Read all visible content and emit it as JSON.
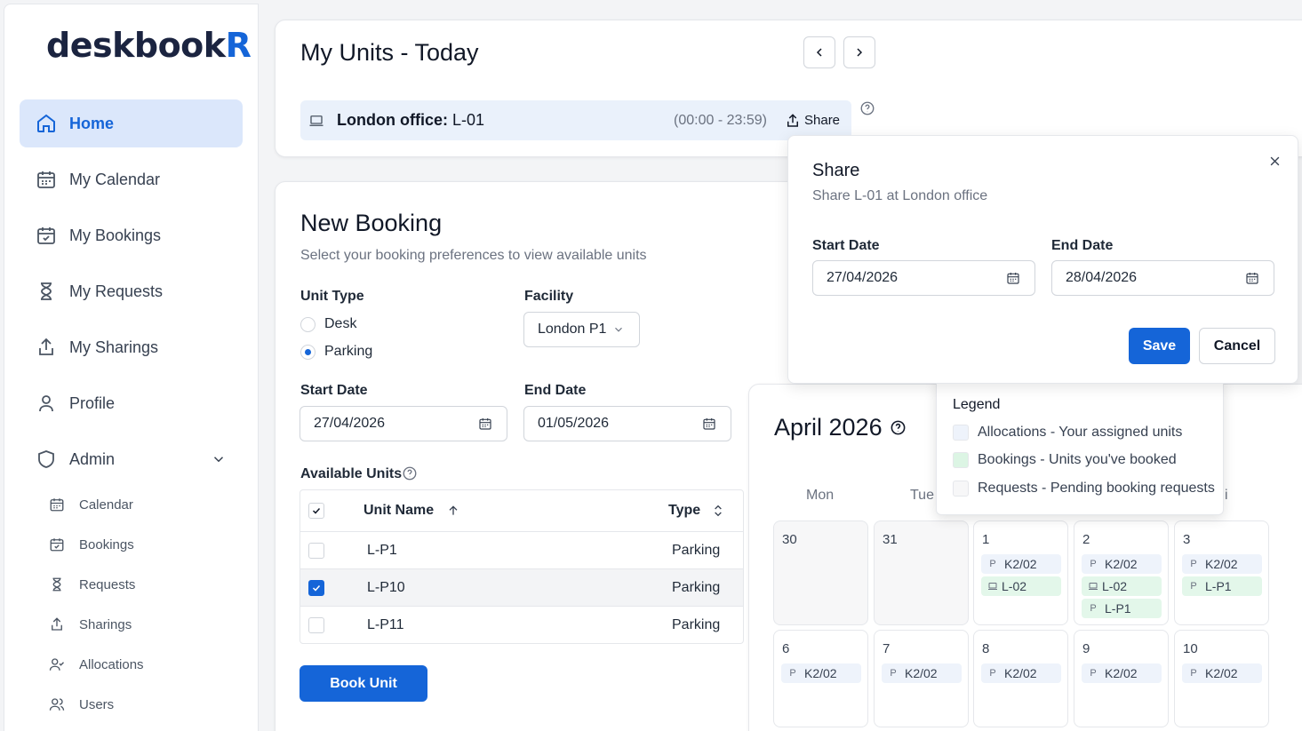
{
  "app": {
    "logo_main": "deskbook",
    "logo_accent": "R"
  },
  "sidebar": {
    "items": [
      {
        "label": "Home",
        "icon": "home-icon",
        "active": true
      },
      {
        "label": "My Calendar",
        "icon": "calendar-icon"
      },
      {
        "label": "My Bookings",
        "icon": "calendar-check-icon"
      },
      {
        "label": "My Requests",
        "icon": "hourglass-icon"
      },
      {
        "label": "My Sharings",
        "icon": "share-icon"
      },
      {
        "label": "Profile",
        "icon": "user-icon"
      },
      {
        "label": "Admin",
        "icon": "shield-icon"
      }
    ],
    "admin_items": [
      {
        "label": "Calendar",
        "icon": "calendar-icon"
      },
      {
        "label": "Bookings",
        "icon": "calendar-check-icon"
      },
      {
        "label": "Requests",
        "icon": "hourglass-icon"
      },
      {
        "label": "Sharings",
        "icon": "share-icon"
      },
      {
        "label": "Allocations",
        "icon": "user-check-icon"
      },
      {
        "label": "Users",
        "icon": "users-icon"
      }
    ]
  },
  "my_units": {
    "title": "My Units - Today",
    "unit_location": "London office:",
    "unit_name": "L-01",
    "time": "(00:00 - 23:59)",
    "share_label": "Share"
  },
  "new_booking": {
    "title": "New Booking",
    "subtitle": "Select your booking preferences to view available units",
    "unit_type_label": "Unit Type",
    "unit_types": [
      {
        "label": "Desk",
        "selected": false
      },
      {
        "label": "Parking",
        "selected": true
      }
    ],
    "facility_label": "Facility",
    "facility_value": "London P1",
    "start_date_label": "Start Date",
    "start_date": "27/04/2026",
    "end_date_label": "End Date",
    "end_date": "01/05/2026",
    "available_units_label": "Available Units",
    "table": {
      "headers": {
        "name": "Unit Name",
        "type": "Type"
      },
      "rows": [
        {
          "name": "L-P1",
          "type": "Parking",
          "checked": false
        },
        {
          "name": "L-P10",
          "type": "Parking",
          "checked": true
        },
        {
          "name": "L-P11",
          "type": "Parking",
          "checked": false
        }
      ]
    },
    "book_button": "Book Unit"
  },
  "share_dialog": {
    "title": "Share",
    "subtitle": "Share L-01 at London office",
    "start_date_label": "Start Date",
    "start_date": "27/04/2026",
    "end_date_label": "End Date",
    "end_date": "28/04/2026",
    "save_label": "Save",
    "cancel_label": "Cancel"
  },
  "calendar": {
    "title": "April 2026",
    "weekdays": [
      "Mon",
      "Tue",
      "",
      "",
      "i"
    ],
    "weeks": [
      [
        {
          "num": "30",
          "other": true,
          "chips": []
        },
        {
          "num": "31",
          "other": true,
          "chips": []
        },
        {
          "num": "1",
          "chips": [
            {
              "kind": "P",
              "label": "K2/02",
              "style": "alloc"
            },
            {
              "kind": "desk",
              "label": "L-02",
              "style": "book"
            }
          ]
        },
        {
          "num": "2",
          "chips": [
            {
              "kind": "P",
              "label": "K2/02",
              "style": "alloc"
            },
            {
              "kind": "desk",
              "label": "L-02",
              "style": "book"
            },
            {
              "kind": "P",
              "label": "L-P1",
              "style": "book"
            }
          ]
        },
        {
          "num": "3",
          "chips": [
            {
              "kind": "P",
              "label": "K2/02",
              "style": "alloc"
            },
            {
              "kind": "P",
              "label": "L-P1",
              "style": "book"
            }
          ]
        }
      ],
      [
        {
          "num": "6",
          "chips": [
            {
              "kind": "P",
              "label": "K2/02",
              "style": "alloc"
            }
          ]
        },
        {
          "num": "7",
          "chips": [
            {
              "kind": "P",
              "label": "K2/02",
              "style": "alloc"
            }
          ]
        },
        {
          "num": "8",
          "chips": [
            {
              "kind": "P",
              "label": "K2/02",
              "style": "alloc"
            }
          ]
        },
        {
          "num": "9",
          "chips": [
            {
              "kind": "P",
              "label": "K2/02",
              "style": "alloc"
            }
          ]
        },
        {
          "num": "10",
          "chips": [
            {
              "kind": "P",
              "label": "K2/02",
              "style": "alloc"
            }
          ]
        }
      ]
    ]
  },
  "legend": {
    "title": "Legend",
    "items": [
      {
        "label": "Allocations - Your assigned units",
        "color": "#eef3fb"
      },
      {
        "label": "Bookings - Units you've booked",
        "color": "#dcf5e4"
      },
      {
        "label": "Requests - Pending booking requests",
        "color": "#f7f7f8"
      }
    ]
  },
  "colors": {
    "accent": "#1565d8",
    "active_bg": "#dbe7fb"
  }
}
